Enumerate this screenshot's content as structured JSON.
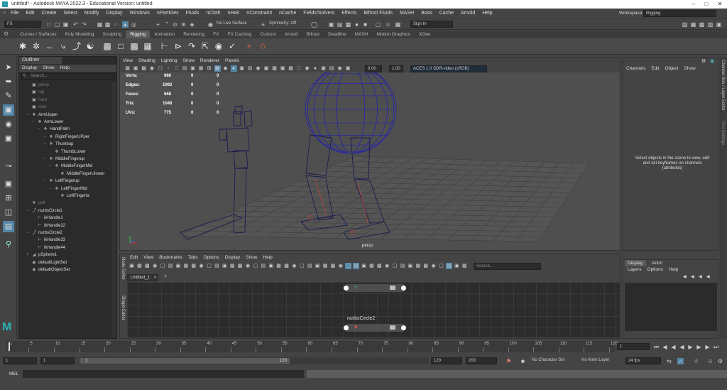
{
  "window": {
    "title": "untitled* - Autodesk MAYA 2022.3 - Educational Version: untitled"
  },
  "menubar": [
    "File",
    "Edit",
    "Create",
    "Select",
    "Modify",
    "Display",
    "Windows",
    "nParticles",
    "Fluids",
    "nCloth",
    "nHair",
    "nConstraint",
    "nCache",
    "Fields/Solvers",
    "Effects",
    "Bifrost Fluids",
    "MASH",
    "Boss",
    "Cache",
    "Arnold",
    "Help"
  ],
  "workspace": {
    "label": "Workspace:",
    "value": "Rigging"
  },
  "statusline": {
    "menuset": "FX",
    "live_surface": "No Live Surface",
    "symmetry": "Symmetry: Off",
    "sign_in": "Sign In"
  },
  "shelf_tabs": [
    "Curves / Surfaces",
    "Poly Modeling",
    "Sculpting",
    "Rigging",
    "Animation",
    "Rendering",
    "FX",
    "FX Caching",
    "Custom",
    "Arnold",
    "Bifrost",
    "Deadline",
    "MASH",
    "Motion Graphics",
    "XGen"
  ],
  "shelf_active": "Rigging",
  "outliner": {
    "tab": "Outliner",
    "menu": [
      "Display",
      "Show",
      "Help"
    ],
    "search_placeholder": "Search...",
    "items": [
      {
        "label": "persp",
        "indent": 0,
        "dim": true,
        "icon": "camera"
      },
      {
        "label": "top",
        "indent": 0,
        "dim": true,
        "icon": "camera"
      },
      {
        "label": "front",
        "indent": 0,
        "dim": true,
        "icon": "camera"
      },
      {
        "label": "side",
        "indent": 0,
        "dim": true,
        "icon": "camera"
      },
      {
        "label": "ArmUpper",
        "indent": 0,
        "icon": "joint",
        "exp": "-"
      },
      {
        "label": "ArmLower",
        "indent": 1,
        "icon": "joint",
        "exp": "-"
      },
      {
        "label": "HandPalm",
        "indent": 2,
        "icon": "joint",
        "exp": "-"
      },
      {
        "label": "RightFingerUPper",
        "indent": 3,
        "icon": "joint",
        "exp": "-"
      },
      {
        "label": "Thumbup",
        "indent": 3,
        "icon": "joint",
        "exp": "-"
      },
      {
        "label": "ThumbLower",
        "indent": 4,
        "icon": "joint"
      },
      {
        "label": "MiddleFingerup",
        "indent": 3,
        "icon": "joint",
        "exp": "-"
      },
      {
        "label": "MiddleFingerMid",
        "indent": 4,
        "icon": "joint",
        "exp": "-"
      },
      {
        "label": "MiddleFingerUlower",
        "indent": 5,
        "icon": "joint"
      },
      {
        "label": "LeftFingerup",
        "indent": 3,
        "icon": "joint",
        "exp": "-"
      },
      {
        "label": "LeftFingerMid",
        "indent": 4,
        "icon": "joint",
        "exp": "-"
      },
      {
        "label": "LeftFingerla",
        "indent": 5,
        "icon": "joint"
      },
      {
        "label": "pelt",
        "indent": 0,
        "dim": true,
        "icon": "joint"
      },
      {
        "label": "nurbsCircle1",
        "indent": 0,
        "icon": "curve",
        "exp": "-"
      },
      {
        "label": "ikHandle1",
        "indent": 1,
        "icon": "ik"
      },
      {
        "label": "ikHandle22",
        "indent": 1,
        "icon": "ik"
      },
      {
        "label": "nurbsCircle2",
        "indent": 0,
        "icon": "curve",
        "exp": "-"
      },
      {
        "label": "ikHandle33",
        "indent": 1,
        "icon": "ik"
      },
      {
        "label": "ikHandle44",
        "indent": 1,
        "icon": "ik"
      },
      {
        "label": "pSphere1",
        "indent": 0,
        "icon": "mesh",
        "exp": "+"
      },
      {
        "label": "defaultLightSet",
        "indent": 0,
        "icon": "set"
      },
      {
        "label": "defaultObjectSet",
        "indent": 0,
        "icon": "set"
      }
    ]
  },
  "viewport": {
    "menu": [
      "View",
      "Shading",
      "Lighting",
      "Show",
      "Renderer",
      "Panels"
    ],
    "exposure": "0.00",
    "gamma": "1.00",
    "colorspace": "ACES 1.0 SDR-video (sRGB)",
    "camera": "persp",
    "hud": [
      {
        "label": "Verts:",
        "v1": "986",
        "v2": "0",
        "v3": "0"
      },
      {
        "label": "Edges:",
        "v1": "1092",
        "v2": "0",
        "v3": "0"
      },
      {
        "label": "Faces:",
        "v1": "568",
        "v2": "0",
        "v3": "0"
      },
      {
        "label": "Tris:",
        "v1": "1048",
        "v2": "0",
        "v3": "0"
      },
      {
        "label": "UVs:",
        "v1": "775",
        "v2": "0",
        "v3": "0"
      }
    ]
  },
  "node_editor": {
    "menu": [
      "Edit",
      "View",
      "Bookmarks",
      "Tabs",
      "Options",
      "Display",
      "Show",
      "Help"
    ],
    "tab": "Untitled_1",
    "search_placeholder": "Search...",
    "side_tabs": [
      "Node Editor",
      "Shape Editor"
    ],
    "node_label": "nurbsCircle2"
  },
  "channel_box": {
    "menu": [
      "Channels",
      "Edit",
      "Object",
      "Show"
    ],
    "message": "Select objects in the scene to view, edit and set keyframes on channels (attributes)"
  },
  "layer_editor": {
    "tabs": [
      "Display",
      "Anim"
    ],
    "menu": [
      "Layers",
      "Options",
      "Help"
    ]
  },
  "right_strip": [
    "Channel Box / Layer Editor",
    "Tool Settings"
  ],
  "timeline": {
    "ticks": [
      "1",
      "5",
      "10",
      "15",
      "20",
      "25",
      "30",
      "35",
      "40",
      "45",
      "50",
      "55",
      "60",
      "65",
      "70",
      "75",
      "80",
      "85",
      "90",
      "95",
      "100",
      "105",
      "110",
      "115",
      "120"
    ],
    "current": "1"
  },
  "range": {
    "start": "1",
    "inner_start": "1",
    "slider_start": "1",
    "slider_end": "120",
    "end": "120",
    "max": "200",
    "character_set": "No Character Set",
    "anim_layer": "No Anim Layer",
    "fps": "24 fps"
  },
  "cmd": {
    "label": "MEL"
  },
  "colors": {
    "select_blue": "#5285a6",
    "wire_blue": "#2b2b9e",
    "joint_red": "#c04040"
  }
}
